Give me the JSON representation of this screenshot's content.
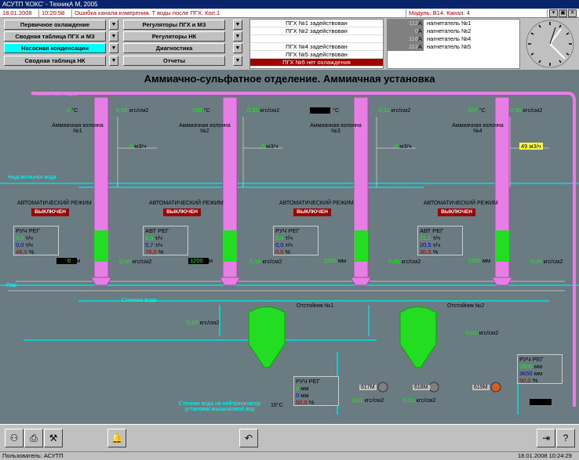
{
  "window": {
    "title": "АСУТП 'КОКС' - ТехникА М, 2005"
  },
  "statusbar": {
    "date": "18.01.2008",
    "time": "10:20:58",
    "error": "Ошибка канала измерения. Т воды после ПГХ. Кол.1",
    "module": "Модуль: В14. Канал: 4"
  },
  "nav": {
    "col1": [
      "Первичное охлаждение",
      "Сводная таблица ПГХ и МЗ",
      "Насосная конденсации",
      "Сводная таблица НК"
    ],
    "col2": [
      "Регуляторы ПГХ и МЗ",
      "Регуляторы НК",
      "Диагностика",
      "Отчеты"
    ]
  },
  "messages": [
    "ПГХ №1 задействован",
    "ПГХ №2 задействован",
    "",
    "ПГХ №4 задействован",
    "ПГХ №5 задействован",
    "ПГХ №6 нет охлаждения"
  ],
  "fans": [
    {
      "value": "112",
      "unit": "А",
      "name": "нагнетатель №1"
    },
    {
      "value": "0",
      "unit": "А",
      "name": "нагнетатель №2"
    },
    {
      "value": "116",
      "unit": "А",
      "name": "нагнетатель №4"
    },
    {
      "value": "112",
      "unit": "А",
      "name": "нагнетатель №5"
    }
  ],
  "scheme": {
    "title": "Аммиачно-сульфатное отделение. Аммиачная установка",
    "ammonia_vapors": "Аммиачные пары",
    "tar_water": "Надсмольная вода",
    "steam": "Пар",
    "waste_water": "Сточная вода",
    "waste_note": "Сточная вода на нейтрализатор установки мышьяковой вод",
    "auto_mode": "АВТОМАТИЧЕСКИЙ РЕЖИМ",
    "off": "ВЫКЛЮЧЕН",
    "columns": [
      {
        "name": "Аммиачная колонна №1",
        "temp": "0",
        "temp_unit": "°С",
        "press": "0,05",
        "press_unit": "кгс/см2",
        "flow": "0",
        "flow_unit": "м3/ч",
        "reg_mode": "РУЧ РЕГ",
        "reg1": "0,0",
        "reg1_unit": "т/ч",
        "reg2": "0,0",
        "reg2_unit": "т/ч",
        "reg3": "48,0",
        "reg3_unit": "%",
        "level": "0",
        "level_unit": "мм",
        "bottom_press": "0,00",
        "bottom_press_unit": "кгс/см2"
      },
      {
        "name": "Аммиачная колонна №2",
        "temp": "100",
        "temp_unit": "°С",
        "press": "0,32",
        "press_unit": "кгс/см2",
        "flow": "0",
        "flow_unit": "м3/ч",
        "reg_mode": "АВТ РЕГ",
        "reg1": "6,3",
        "reg1_unit": "т/ч",
        "reg2": "5,7",
        "reg2_unit": "т/ч",
        "reg3": "78,0",
        "reg3_unit": "%",
        "level": "1200",
        "level_unit": "мм",
        "bottom_press": "0,10",
        "bottom_press_unit": "кгс/см2"
      },
      {
        "name": "Аммиачная колонна №3",
        "temp": "",
        "temp_unit": "°С",
        "press": "0,32",
        "press_unit": "кгс/см2",
        "flow": "0",
        "flow_unit": "м3/ч",
        "reg_mode": "РУЧ РЕГ",
        "reg1": "0,0",
        "reg1_unit": "т/ч",
        "reg2": "0,0",
        "reg2_unit": "т/ч",
        "reg3": "0,0",
        "reg3_unit": "%",
        "level": "1500",
        "level_unit": "мм",
        "bottom_press": "0,00",
        "bottom_press_unit": "кгс/см2"
      },
      {
        "name": "Аммиачная колонна №4",
        "temp": "107",
        "temp_unit": "°С",
        "press": "0,30",
        "press_unit": "кгс/см2",
        "flow": "49",
        "flow_unit": "м3/ч",
        "reg_mode": "АВТ РЕГ",
        "reg1": "21,1",
        "reg1_unit": "т/ч",
        "reg2": "20,5",
        "reg2_unit": "т/ч",
        "reg3": "30,5",
        "reg3_unit": "%",
        "level": "1500",
        "level_unit": "мм",
        "bottom_press": "0,00",
        "bottom_press_unit": "кгс/см2"
      }
    ],
    "settlers": [
      {
        "name": "Отстойник №1",
        "press": "0,02",
        "press_unit": "кгс/см2"
      },
      {
        "name": "Отстойник №2",
        "press": "0,01",
        "press_unit": "кгс/см2"
      }
    ],
    "reg_bottom": {
      "mode": "РУЧ РЕГ",
      "v1": "0",
      "v1_unit": "мм",
      "v2": "0",
      "v2_unit": "мм",
      "v3": "50,0",
      "v3_unit": "%"
    },
    "reg_right": {
      "mode": "РУЧ РЕГ",
      "v1": "2800",
      "v1_unit": "мм",
      "v2": "3650",
      "v2_unit": "мм",
      "v3": "50,0",
      "v3_unit": "%"
    },
    "pumps": [
      {
        "name": "617М",
        "press": "0,02",
        "press_unit": "кгс/см2"
      },
      {
        "name": "618М",
        "press": "0,01",
        "press_unit": "кгс/см2"
      },
      {
        "name": "619М",
        "press": "",
        "press_unit": ""
      }
    ],
    "temp_bottom_label": "16°С"
  },
  "footer": {
    "user": "Пользователь: АСУТП",
    "datetime": "18.01.2008  10:24:29"
  },
  "colors": {
    "background": "#6b7b82",
    "column": "#e67ee6",
    "settler": "#22dd22",
    "pipe": "#00e0e0",
    "alarm": "#a00000"
  }
}
